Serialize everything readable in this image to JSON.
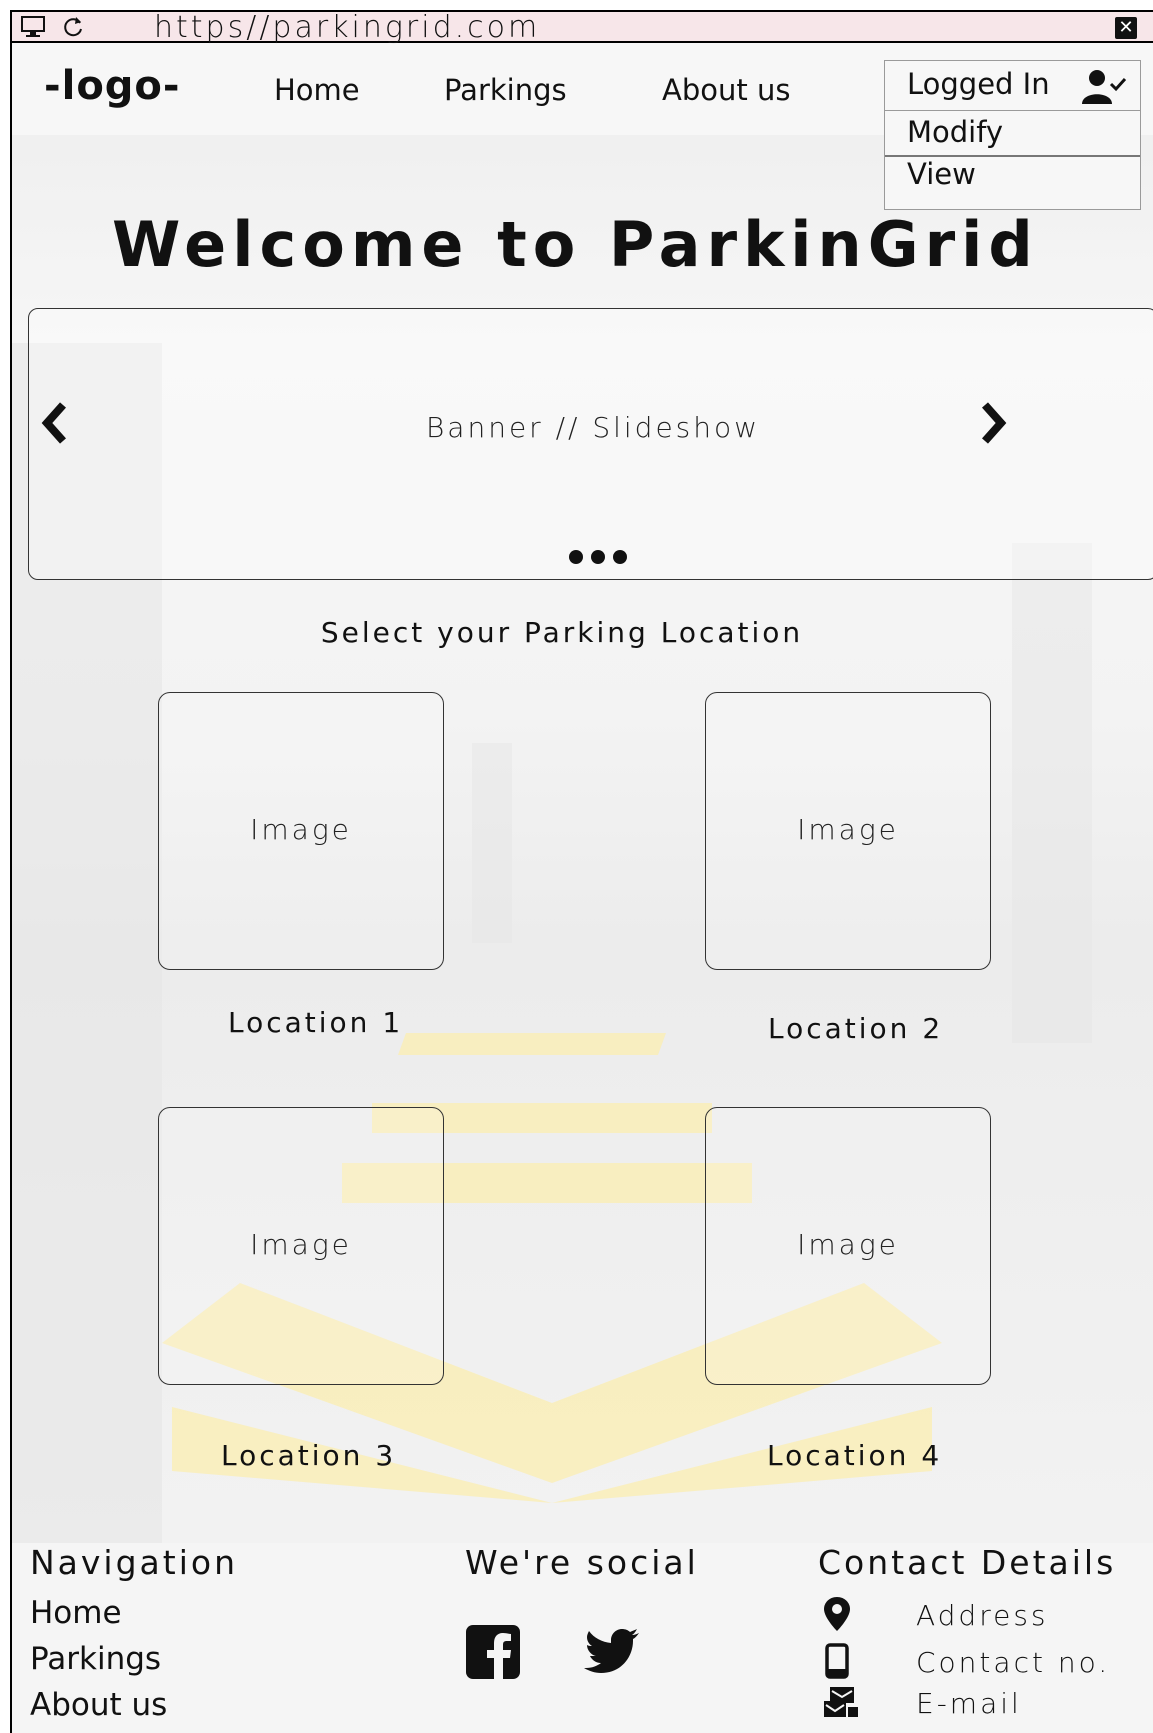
{
  "browser": {
    "url": "https//parkingrid.com"
  },
  "header": {
    "logo": "-logo-",
    "nav": [
      "Home",
      "Parkings",
      "About us"
    ],
    "account": {
      "label": "Logged In",
      "menu": [
        "Modify",
        "View"
      ]
    }
  },
  "hero": {
    "title": "Welcome to ParkinGrid"
  },
  "banner": {
    "label": "Banner // Slideshow"
  },
  "locations": {
    "heading": "Select your Parking Location",
    "items": [
      {
        "image": "Image",
        "name": "Location 1"
      },
      {
        "image": "Image",
        "name": "Location 2"
      },
      {
        "image": "Image",
        "name": "Location 3"
      },
      {
        "image": "Image",
        "name": "Location 4"
      }
    ]
  },
  "footer": {
    "navigation": {
      "title": "Navigation",
      "links": [
        "Home",
        "Parkings",
        "About us"
      ]
    },
    "social": {
      "title": "We're social",
      "icons": [
        "facebook-icon",
        "twitter-icon"
      ]
    },
    "contact": {
      "title": "Contact Details",
      "items": [
        {
          "icon": "location-pin-icon",
          "label": "Address"
        },
        {
          "icon": "phone-icon",
          "label": "Contact no."
        },
        {
          "icon": "mail-icon",
          "label": "E-mail"
        }
      ]
    }
  }
}
